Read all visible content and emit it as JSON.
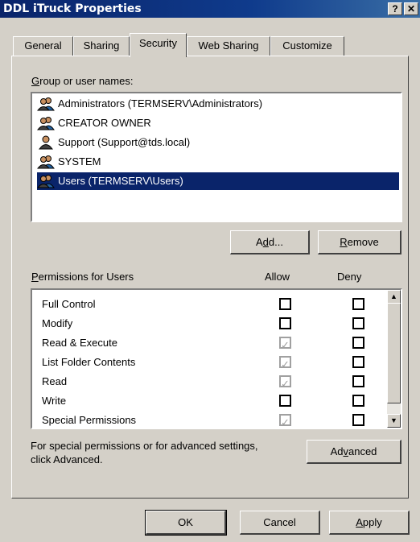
{
  "window": {
    "title": "DDL iTruck Properties",
    "help": "?",
    "close": "✕"
  },
  "tabs": [
    "General",
    "Sharing",
    "Security",
    "Web Sharing",
    "Customize"
  ],
  "active_tab": "Security",
  "group_label": {
    "hot": "G",
    "rest": "roup or user names:"
  },
  "users": [
    {
      "name": "Administrators (TERMSERV\\Administrators)",
      "icon": "group-icon",
      "selected": false
    },
    {
      "name": "CREATOR OWNER",
      "icon": "group-icon",
      "selected": false
    },
    {
      "name": "Support (Support@tds.local)",
      "icon": "user-icon",
      "selected": false
    },
    {
      "name": "SYSTEM",
      "icon": "group-icon",
      "selected": false
    },
    {
      "name": "Users (TERMSERV\\Users)",
      "icon": "group-icon",
      "selected": true
    }
  ],
  "buttons": {
    "add": {
      "pre": "A",
      "hot": "d",
      "post": "d..."
    },
    "remove": {
      "pre": "",
      "hot": "R",
      "post": "emove"
    },
    "advanced": {
      "pre": "Ad",
      "hot": "v",
      "post": "anced"
    },
    "ok": "OK",
    "cancel": "Cancel",
    "apply": {
      "pre": "",
      "hot": "A",
      "post": "pply"
    }
  },
  "permissions": {
    "label_hot": "P",
    "label_rest": "ermissions for Users",
    "allow_header": "Allow",
    "deny_header": "Deny",
    "rows": [
      {
        "name": "Full Control",
        "allow": "empty",
        "deny": "empty"
      },
      {
        "name": "Modify",
        "allow": "empty",
        "deny": "empty"
      },
      {
        "name": "Read & Execute",
        "allow": "checked-disabled",
        "deny": "empty"
      },
      {
        "name": "List Folder Contents",
        "allow": "checked-disabled",
        "deny": "empty"
      },
      {
        "name": "Read",
        "allow": "checked-disabled",
        "deny": "empty"
      },
      {
        "name": "Write",
        "allow": "empty",
        "deny": "empty"
      },
      {
        "name": "Special Permissions",
        "allow": "checked-disabled",
        "deny": "empty"
      }
    ]
  },
  "advanced_note": "For special permissions or for advanced settings,\nclick Advanced.",
  "colors": {
    "selection": "#0a246a",
    "face": "#d4d0c8",
    "title_start": "#0a246a"
  }
}
